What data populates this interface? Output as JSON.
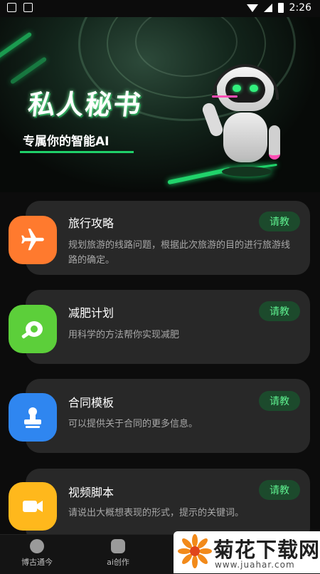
{
  "status_bar": {
    "time": "2:26"
  },
  "hero": {
    "title": "私人秘书",
    "subtitle": "专属你的智能AI"
  },
  "cards": [
    {
      "title": "旅行攻略",
      "description": "规划旅游的线路问题，根据此次旅游的目的进行旅游线路的确定。",
      "button": "请教",
      "icon": "airplane-icon",
      "color": "#ff7a2e"
    },
    {
      "title": "减肥计划",
      "description": "用科学的方法帮你实现减肥",
      "button": "请教",
      "icon": "meat-icon",
      "color": "#5ccf3a"
    },
    {
      "title": "合同模板",
      "description": "可以提供关于合同的更多信息。",
      "button": "请教",
      "icon": "stamp-icon",
      "color": "#2f86f0"
    },
    {
      "title": "视频脚本",
      "description": "请说出大概想表现的形式，提示的关键词。",
      "button": "请教",
      "icon": "video-camera-icon",
      "color": "#ffb81c"
    }
  ],
  "bottom_nav": [
    {
      "label": "博古通今",
      "icon": "skull-icon"
    },
    {
      "label": "ai创作",
      "icon": "ai-head-icon"
    }
  ],
  "watermark": {
    "title": "菊花下载网",
    "url": "www.juahar.com"
  }
}
